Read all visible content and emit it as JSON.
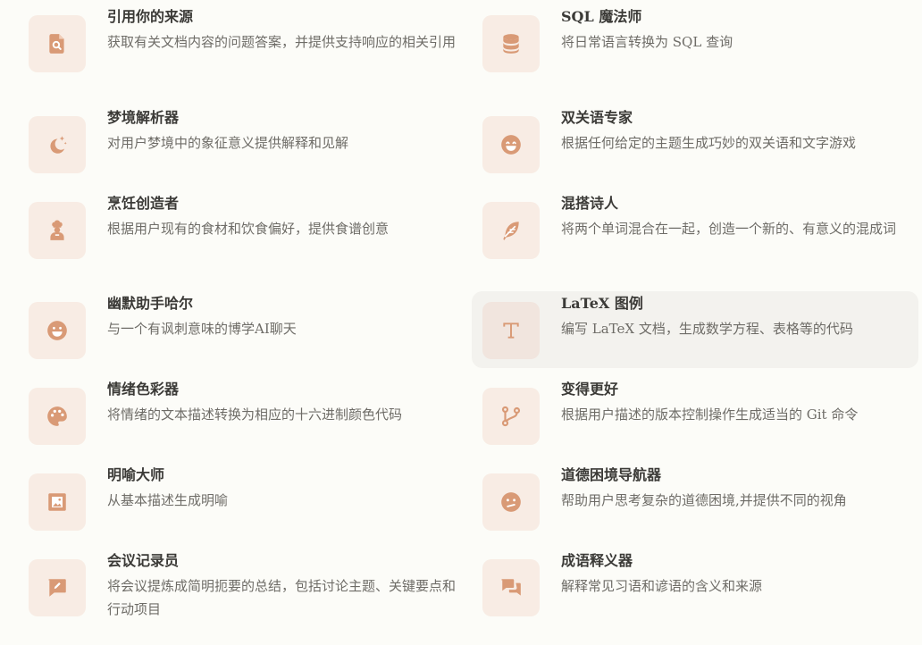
{
  "accent_color": "#d99a76",
  "icon_bg_color": "#f8ece4",
  "cards": [
    {
      "title": "引用你的来源",
      "desc": "获取有关文档内容的问题答案，并提供支持响应的相关引用",
      "icon": "document-search-icon"
    },
    {
      "title": "SQL 魔法师",
      "desc": "将日常语言转换为 SQL 查询",
      "icon": "database-icon"
    },
    {
      "title": "梦境解析器",
      "desc": "对用户梦境中的象征意义提供解释和见解",
      "icon": "moon-stars-icon"
    },
    {
      "title": "双关语专家",
      "desc": "根据任何给定的主题生成巧妙的双关语和文字游戏",
      "icon": "grin-face-icon"
    },
    {
      "title": "烹饪创造者",
      "desc": "根据用户现有的食材和饮食偏好，提供食谱创意",
      "icon": "chef-icon"
    },
    {
      "title": "混搭诗人",
      "desc": "将两个单词混合在一起，创造一个新的、有意义的混成词",
      "icon": "feather-icon"
    },
    {
      "title": "幽默助手哈尔",
      "desc": "与一个有讽刺意味的博学AI聊天",
      "icon": "laugh-face-icon"
    },
    {
      "title": "LaTeX 图例",
      "desc": "编写 LaTeX 文档，生成数学方程、表格等的代码",
      "icon": "text-t-icon"
    },
    {
      "title": "情绪色彩器",
      "desc": "将情绪的文本描述转换为相应的十六进制颜色代码",
      "icon": "palette-icon"
    },
    {
      "title": "变得更好",
      "desc": "根据用户描述的版本控制操作生成适当的 Git 命令",
      "icon": "git-branch-icon"
    },
    {
      "title": "明喻大师",
      "desc": "从基本描述生成明喻",
      "icon": "frame-icon"
    },
    {
      "title": "道德困境导航器",
      "desc": "帮助用户思考复杂的道德困境,并提供不同的视角",
      "icon": "confused-face-icon"
    },
    {
      "title": "会议记录员",
      "desc": "将会议提炼成简明扼要的总结，包括讨论主题、关键要点和行动项目",
      "icon": "chat-pencil-icon"
    },
    {
      "title": "成语释义器",
      "desc": "解释常见习语和谚语的含义和来源",
      "icon": "chat-bubbles-icon"
    }
  ]
}
